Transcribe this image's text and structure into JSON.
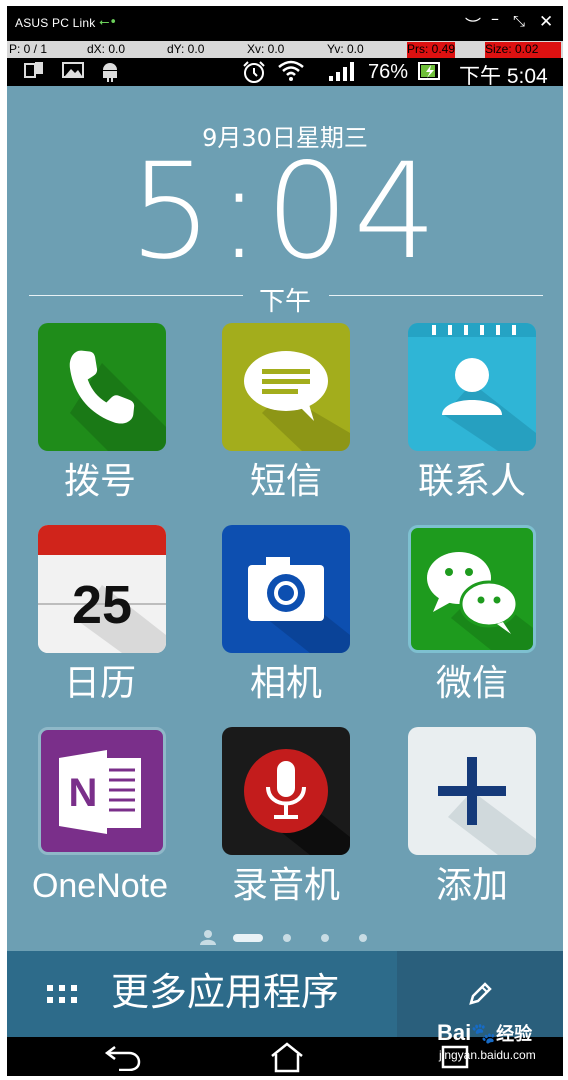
{
  "window": {
    "title": "ASUS PC Link",
    "usb_icon": "usb-icon",
    "controls": [
      "minimize-chevron-icon",
      "minimize-icon",
      "fullscreen-icon",
      "close-icon"
    ]
  },
  "debug": {
    "p": "P: 0 / 1",
    "dx": "dX: 0.0",
    "dy": "dY: 0.0",
    "xv": "Xv: 0.0",
    "yv": "Yv: 0.0",
    "prs": "Prs: 0.49",
    "size": "Size: 0.02"
  },
  "status": {
    "left_icons": [
      "sim-icon",
      "image-icon",
      "android-icon"
    ],
    "right_icons": [
      "alarm-icon",
      "wifi-icon",
      "signal-icon",
      "battery-charging-icon"
    ],
    "battery": "76%",
    "time": "下午 5:04"
  },
  "home": {
    "date": "9月30日星期三",
    "clock": "5:04",
    "ampm": "下午",
    "apps": [
      {
        "label": "拨号",
        "icon": "phone-icon",
        "color": "#1f8c1a"
      },
      {
        "label": "短信",
        "icon": "message-icon",
        "color": "#a3ad1c"
      },
      {
        "label": "联系人",
        "icon": "contact-icon",
        "color": "#2fb5d6"
      },
      {
        "label": "日历",
        "icon": "calendar-icon",
        "day": "25",
        "color": "#d0241b"
      },
      {
        "label": "相机",
        "icon": "camera-icon",
        "color": "#0d4fb0"
      },
      {
        "label": "微信",
        "icon": "wechat-icon",
        "color": "#1e9b1e"
      },
      {
        "label": "OneNote",
        "icon": "onenote-icon",
        "letter": "N",
        "color": "#7a2f8a"
      },
      {
        "label": "录音机",
        "icon": "microphone-icon",
        "color": "#c31c1c"
      },
      {
        "label": "添加",
        "icon": "plus-icon",
        "color": "#e9eef0"
      }
    ]
  },
  "bottom": {
    "more_apps": "更多应用程序",
    "grid_icon": "grid-icon",
    "edit_icon": "pencil-icon"
  },
  "nav": {
    "back_icon": "back-icon",
    "home_icon": "home-icon",
    "recent_icon": "recent-apps-icon"
  },
  "watermark": {
    "brand": "Bai",
    "brand2": "经验",
    "url": "jingyan.baidu.com"
  }
}
